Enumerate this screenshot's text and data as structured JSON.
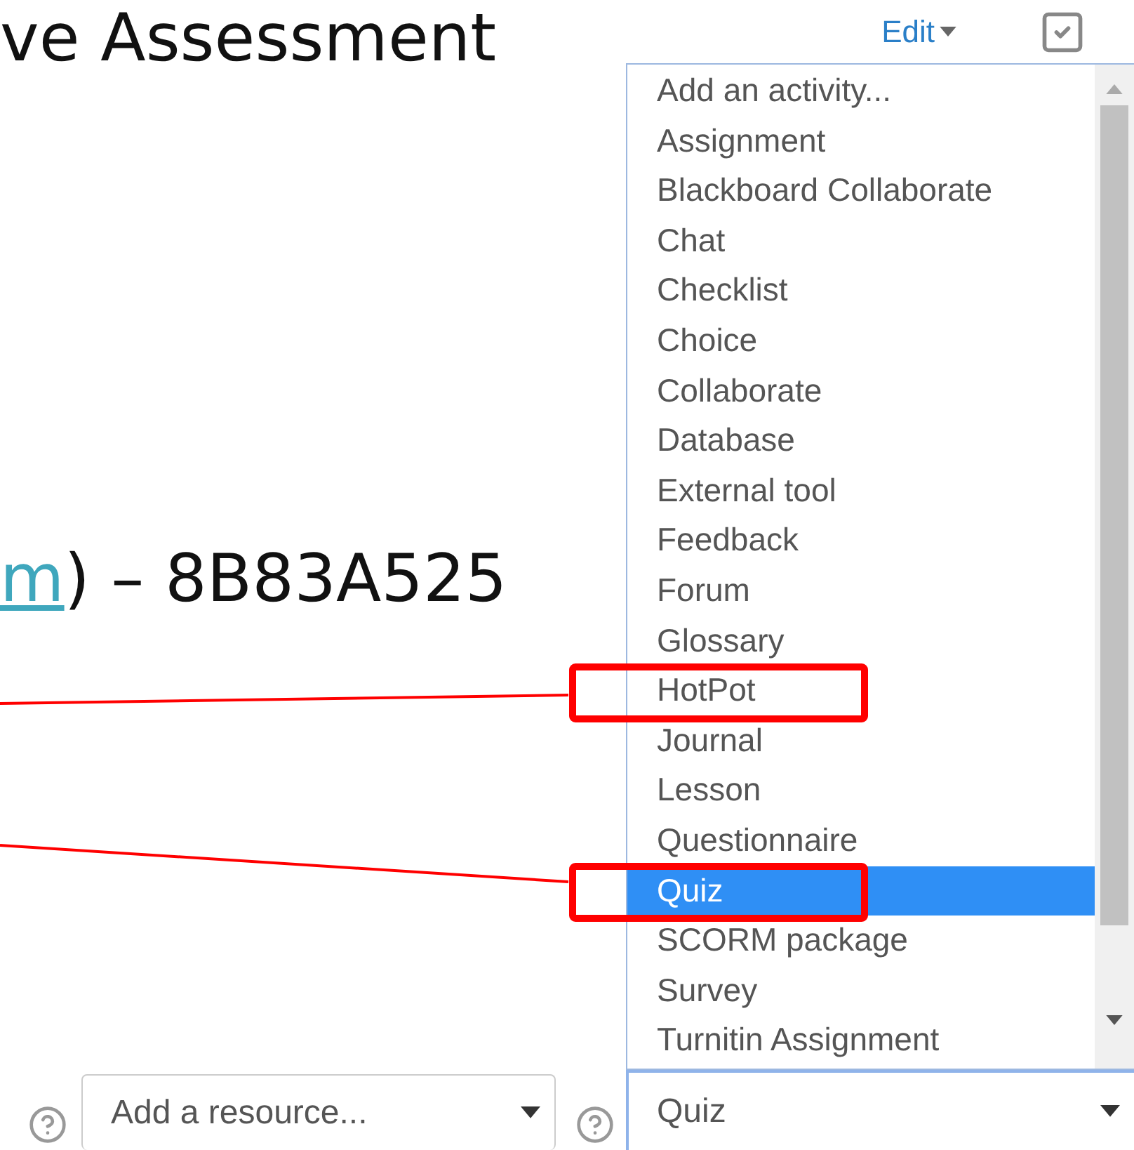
{
  "heading": "ve Assessment",
  "code_line": {
    "link": "m",
    "rest": ") – 8B83A525"
  },
  "edit_menu": {
    "label": "Edit"
  },
  "activity_list": {
    "items": [
      {
        "label": "Add an activity...",
        "selected": false
      },
      {
        "label": "Assignment",
        "selected": false
      },
      {
        "label": "Blackboard Collaborate",
        "selected": false
      },
      {
        "label": "Chat",
        "selected": false
      },
      {
        "label": "Checklist",
        "selected": false
      },
      {
        "label": "Choice",
        "selected": false
      },
      {
        "label": "Collaborate",
        "selected": false
      },
      {
        "label": "Database",
        "selected": false
      },
      {
        "label": "External tool",
        "selected": false
      },
      {
        "label": "Feedback",
        "selected": false
      },
      {
        "label": "Forum",
        "selected": false
      },
      {
        "label": "Glossary",
        "selected": false
      },
      {
        "label": "HotPot",
        "selected": false
      },
      {
        "label": "Journal",
        "selected": false
      },
      {
        "label": "Lesson",
        "selected": false
      },
      {
        "label": "Questionnaire",
        "selected": false
      },
      {
        "label": "Quiz",
        "selected": true
      },
      {
        "label": "SCORM package",
        "selected": false
      },
      {
        "label": "Survey",
        "selected": false
      },
      {
        "label": "Turnitin Assignment",
        "selected": false
      }
    ]
  },
  "resource_select": {
    "value": "Add a resource..."
  },
  "activity_select": {
    "value": "Quiz"
  }
}
